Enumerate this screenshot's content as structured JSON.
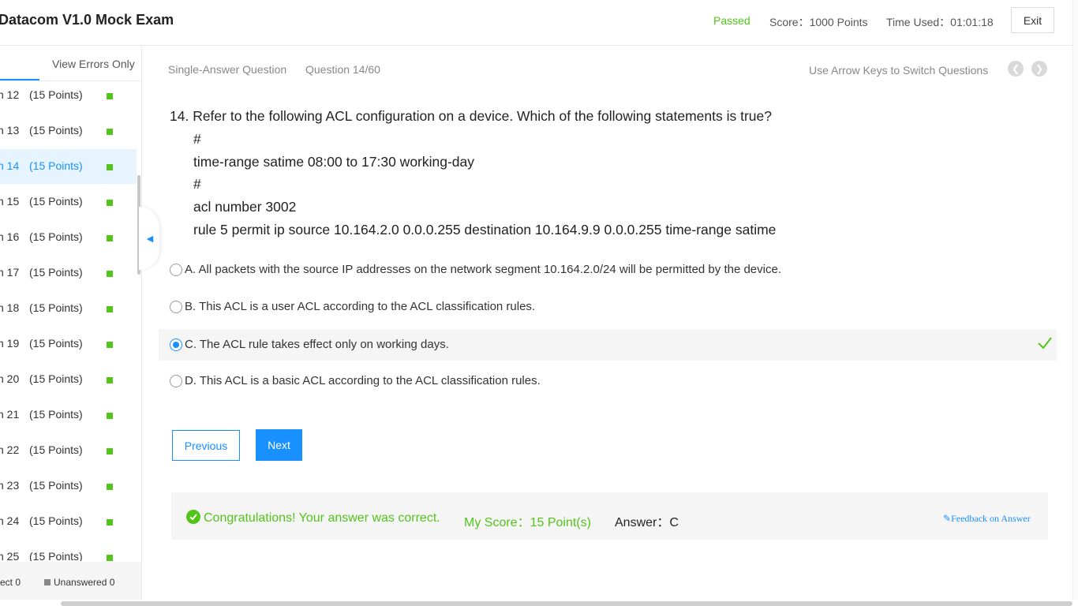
{
  "header": {
    "title": "Datacom V1.0 Mock Exam",
    "status": "Passed",
    "score": "Score：1000 Points",
    "time_used": "Time Used：01:01:18",
    "exit_label": "Exit"
  },
  "sidebar": {
    "view_errors_label": "View Errors Only",
    "items": [
      {
        "num": "n 12",
        "points": "(15 Points)"
      },
      {
        "num": "n 13",
        "points": "(15 Points)"
      },
      {
        "num": "n 14",
        "points": "(15 Points)"
      },
      {
        "num": "n 15",
        "points": "(15 Points)"
      },
      {
        "num": "n 16",
        "points": "(15 Points)"
      },
      {
        "num": "n 17",
        "points": "(15 Points)"
      },
      {
        "num": "n 18",
        "points": "(15 Points)"
      },
      {
        "num": "n 19",
        "points": "(15 Points)"
      },
      {
        "num": "n 20",
        "points": "(15 Points)"
      },
      {
        "num": "n 21",
        "points": "(15 Points)"
      },
      {
        "num": "n 22",
        "points": "(15 Points)"
      },
      {
        "num": "n 23",
        "points": "(15 Points)"
      },
      {
        "num": "n 24",
        "points": "(15 Points)"
      },
      {
        "num": "n 25",
        "points": "(15 Points)"
      }
    ],
    "active_index": 2,
    "footer_correct": "ect 0",
    "footer_unanswered": "Unanswered 0"
  },
  "main": {
    "question_type": "Single-Answer Question",
    "question_counter": "Question 14/60",
    "arrow_hint": "Use Arrow Keys to Switch Questions",
    "question_text": "14. Refer to the following ACL configuration on a device. Which of the following statements is true?",
    "code_lines": [
      "#",
      "time-range satime 08:00 to 17:30 working-day",
      "#",
      "acl number 3002",
      "rule 5 permit ip source 10.164.2.0 0.0.0.255 destination 10.164.9.9 0.0.0.255 time-range satime"
    ],
    "options": [
      {
        "text": "A. All packets with the source IP addresses on the network segment 10.164.2.0/24 will be permitted by the device."
      },
      {
        "text": "B. This ACL is a user ACL according to the ACL classification rules."
      },
      {
        "text": "C. The ACL rule takes effect only on working days."
      },
      {
        "text": "D. This ACL is a basic ACL according to the ACL classification rules."
      }
    ],
    "selected_option": 2,
    "prev_label": "Previous",
    "next_label": "Next"
  },
  "result": {
    "congrats": "Congratulations! Your answer was correct.",
    "my_score": "My Score：15 Point(s)",
    "answer": "Answer：C",
    "feedback": "Feedback on Answer"
  },
  "colors": {
    "accent": "#1890ff",
    "success": "#52c41a"
  }
}
